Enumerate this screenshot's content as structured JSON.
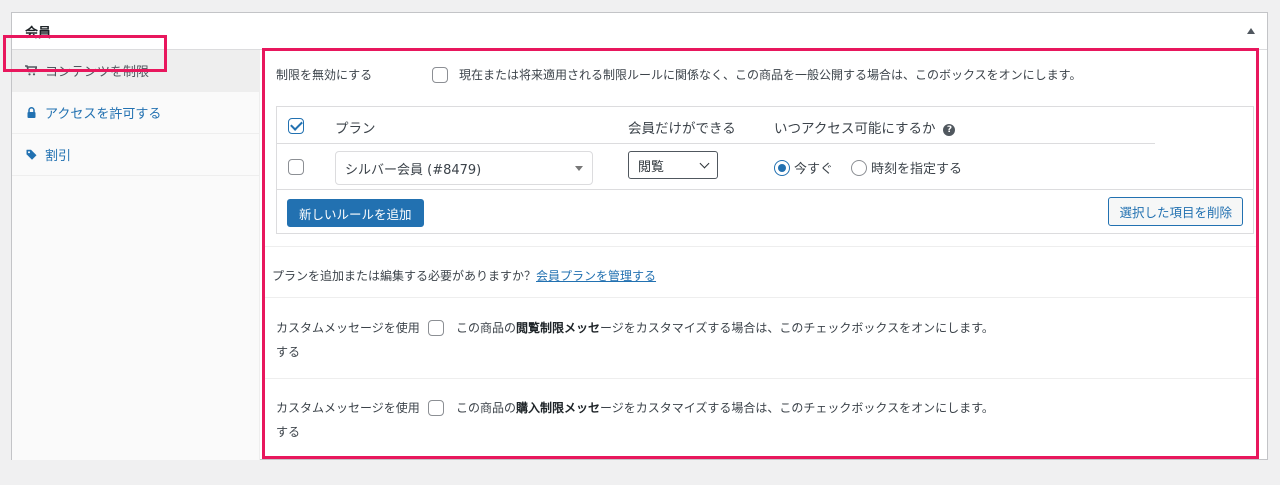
{
  "metabox": {
    "title": "会員"
  },
  "tabs": [
    {
      "label": "コンテンツを制限",
      "icon": "cart-icon"
    },
    {
      "label": "アクセスを許可する",
      "icon": "lock-icon"
    },
    {
      "label": "割引",
      "icon": "tag-icon"
    }
  ],
  "force_public": {
    "label": "制限を無効にする",
    "description": "現在または将来適用される制限ルールに関係なく、この商品を一般公開する場合は、このボックスをオンにします。",
    "checked": false
  },
  "rules_table": {
    "headers": {
      "plan": "プラン",
      "access": "会員だけができる",
      "when": "いつアクセス可能にするか"
    },
    "rows": [
      {
        "plan": "シルバー会員 (#8479)",
        "access": "閲覧",
        "when_options": [
          "今すぐ",
          "時刻を指定する"
        ],
        "when_selected": "今すぐ"
      }
    ],
    "add_button": "新しいルールを追加",
    "delete_button": "選択した項目を削除"
  },
  "manage_plans": {
    "text": "プランを追加または編集する必要がありますか？",
    "link": "会員プランを管理する"
  },
  "custom_messages": [
    {
      "label": "カスタムメッセージを使用する",
      "desc_before": "この商品の",
      "desc_bold": "閲覧制限メッセ",
      "desc_after": "ージをカスタマイズする場合は、このチェックボックスをオンにします。"
    },
    {
      "label": "カスタムメッセージを使用する",
      "desc_before": "この商品の",
      "desc_bold": "購入制限メッセ",
      "desc_after": "ージをカスタマイズする場合は、このチェックボックスをオンにします。"
    }
  ],
  "colors": {
    "accent": "#2271b1",
    "highlight": "#e8175d"
  }
}
